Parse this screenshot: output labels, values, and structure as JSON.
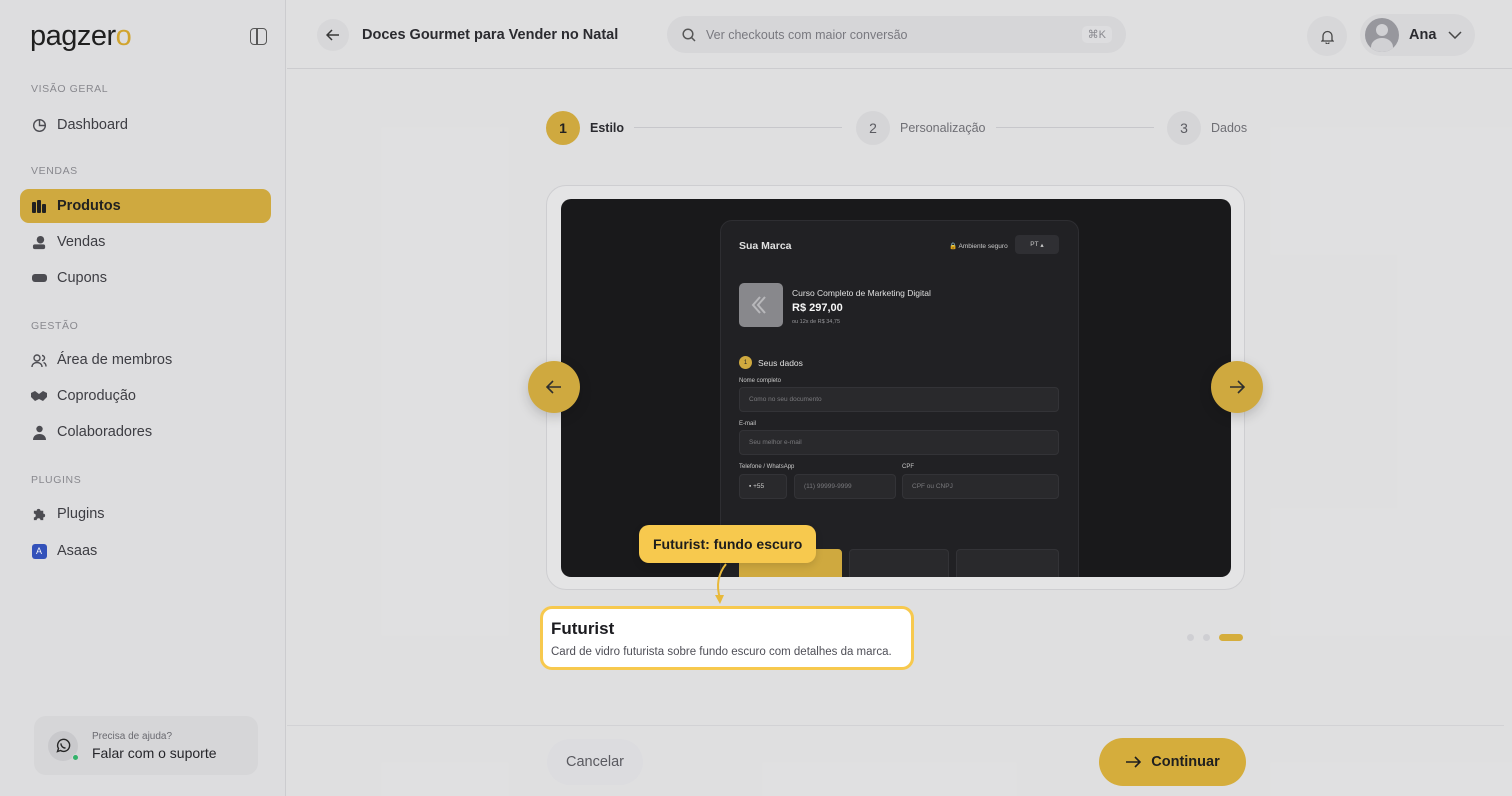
{
  "brand": {
    "logo_text": "pagzer",
    "logo_accent": "o",
    "accent_color": "#d5ad3c"
  },
  "sidebar": {
    "sections": [
      {
        "title": "VISÃO GERAL",
        "items": [
          {
            "label": "Dashboard",
            "icon": "chart-icon"
          }
        ]
      },
      {
        "title": "VENDAS",
        "items": [
          {
            "label": "Produtos",
            "icon": "box-icon",
            "active": true
          },
          {
            "label": "Vendas",
            "icon": "money-icon"
          },
          {
            "label": "Cupons",
            "icon": "ticket-icon"
          }
        ]
      },
      {
        "title": "GESTÃO",
        "items": [
          {
            "label": "Área de membros",
            "icon": "users-icon"
          },
          {
            "label": "Coprodução",
            "icon": "handshake-icon"
          },
          {
            "label": "Colaboradores",
            "icon": "user-icon"
          }
        ]
      },
      {
        "title": "PLUGINS",
        "items": [
          {
            "label": "Plugins",
            "icon": "puzzle-icon"
          },
          {
            "label": "Asaas",
            "icon": "asaas-icon"
          }
        ]
      }
    ],
    "support": {
      "small": "Precisa de ajuda?",
      "big": "Falar com o suporte"
    }
  },
  "header": {
    "title": "Doces Gourmet para Vender no Natal",
    "search_placeholder": "Ver checkouts com maior conversão",
    "shortcut": "⌘K",
    "user_name": "Ana"
  },
  "stepper": [
    {
      "num": "1",
      "label": "Estilo",
      "active": true
    },
    {
      "num": "2",
      "label": "Personalização",
      "active": false
    },
    {
      "num": "3",
      "label": "Dados",
      "active": false
    }
  ],
  "checkout_preview": {
    "brand": "Sua Marca",
    "secure": "Ambiente seguro",
    "lang": "PT",
    "product": "Curso Completo de Marketing Digital",
    "price": "R$ 297,00",
    "installments": "ou 12x de R$ 34,75",
    "step_num": "1",
    "step_title": "Seus dados",
    "name_label": "Nome completo",
    "name_placeholder": "Como no seu documento",
    "email_label": "E-mail",
    "email_placeholder": "Seu melhor e-mail",
    "phone_label": "Telefone / WhatsApp",
    "phone_code": "+55",
    "phone_placeholder": "(11) 99999-9999",
    "cpf_label": "CPF",
    "cpf_placeholder": "CPF ou CNPJ"
  },
  "tooltip": "Futurist: fundo escuro",
  "template_info": {
    "title": "Futurist",
    "description": "Card de vidro futurista sobre fundo escuro com detalhes da marca."
  },
  "carousel": {
    "count": 3,
    "current": 3
  },
  "footer": {
    "cancel": "Cancelar",
    "continue": "Continuar"
  }
}
